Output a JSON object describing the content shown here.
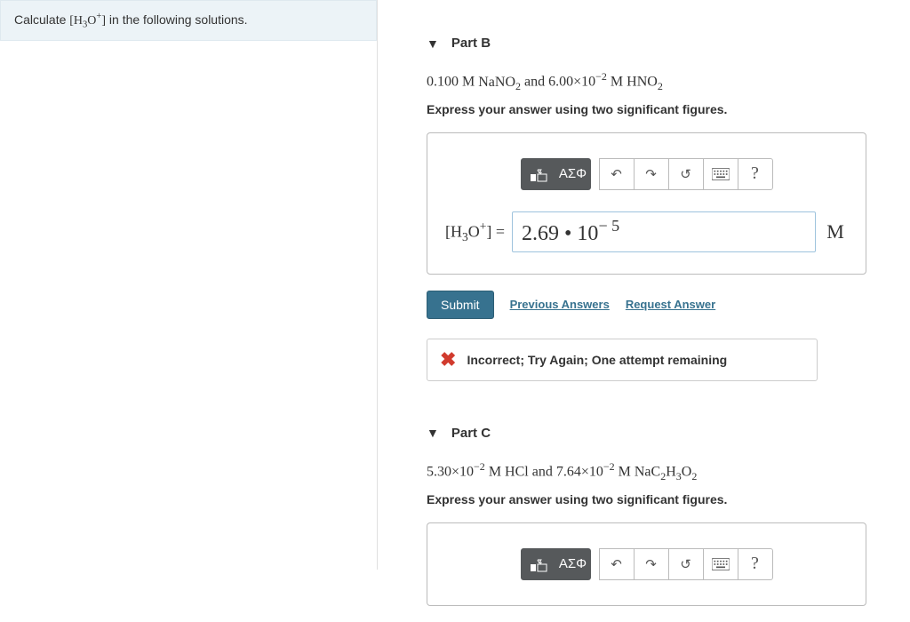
{
  "question": {
    "prefix": "Calculate ",
    "species_html": "[H<sub>3</sub>O<sup>+</sup>]",
    "suffix": " in the following solutions."
  },
  "toolbar": {
    "templates_tip": "Templates",
    "symbols_label": "ΑΣΦ",
    "undo_tip": "Undo",
    "redo_tip": "Redo",
    "reset_tip": "Reset",
    "keyboard_tip": "Keyboard shortcuts",
    "help_label": "?"
  },
  "partB": {
    "title": "Part B",
    "prompt_html": "0.100 M <span style='font-family:Georgia'>NaNO<sub>2</sub></span> and 6.00×10<sup>−2</sup> M <span style='text-decoration:overline'></span>HNO<sub>2</sub>",
    "instruction": "Express your answer using two significant figures.",
    "answer_label_html": "[H<sub>3</sub>O<sup>+</sup>] =",
    "answer_value_html": "2.69 • 10<sup>− 5</sup>",
    "answer_unit": "M",
    "submit": "Submit",
    "prev_answers": "Previous Answers",
    "request_answer": "Request Answer",
    "feedback": "Incorrect; Try Again; One attempt remaining"
  },
  "partC": {
    "title": "Part C",
    "prompt_html": "5.30×10<sup>−2</sup> M HCl and 7.64×10<sup>−2</sup> M NaC<sub>2</sub>H<sub>3</sub>O<sub>2</sub>",
    "instruction": "Express your answer using two significant figures."
  }
}
